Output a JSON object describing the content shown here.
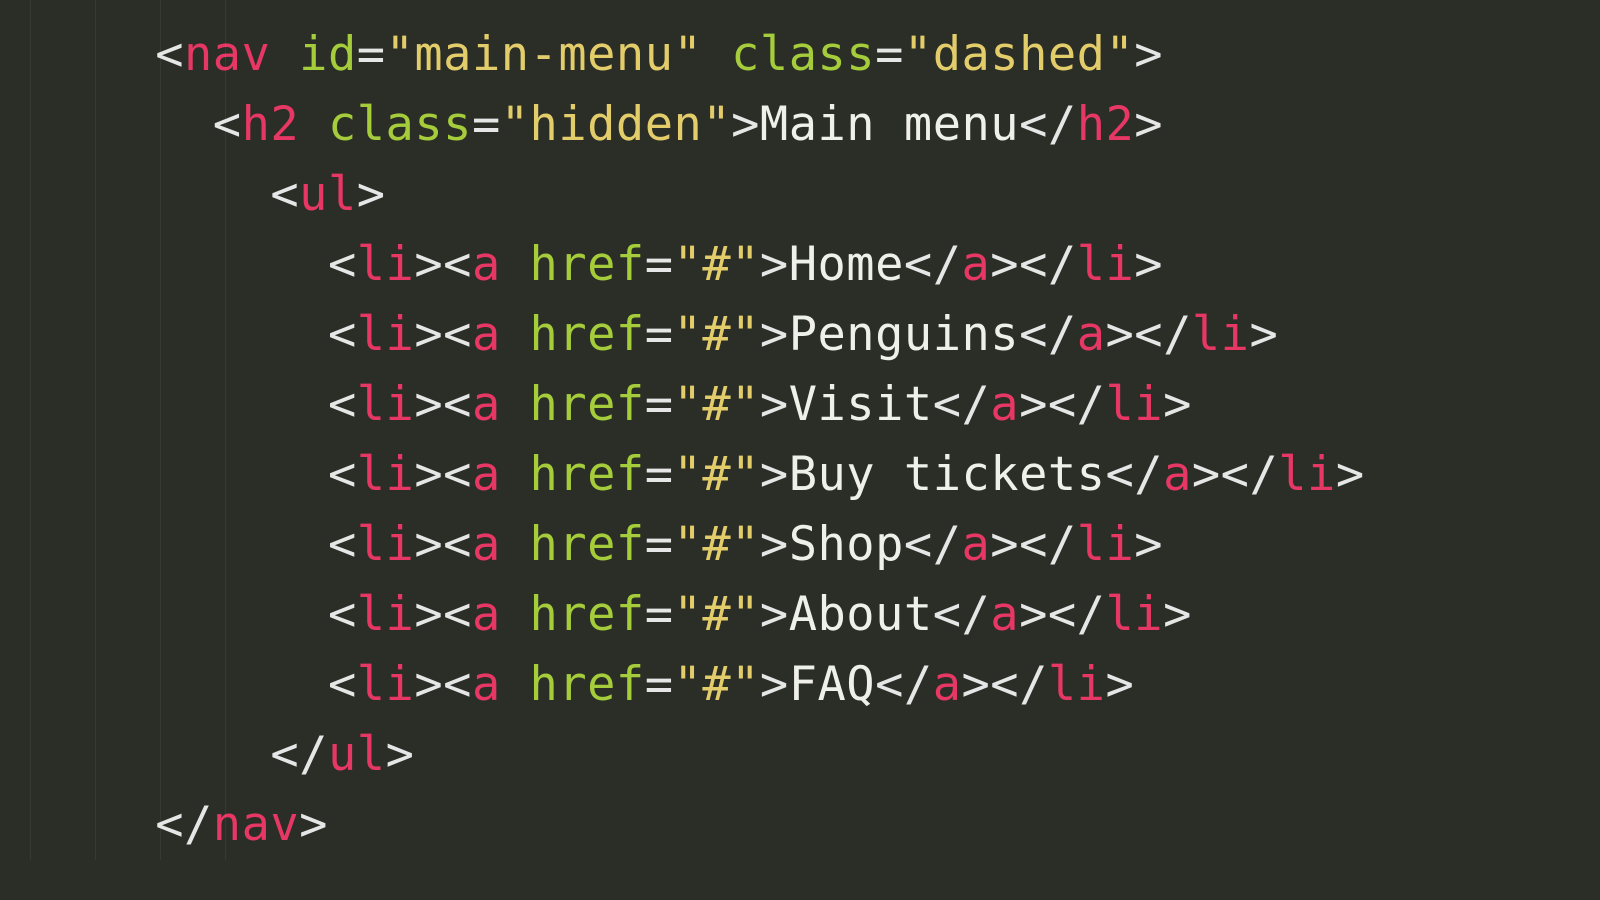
{
  "code": {
    "indent_unit": "  ",
    "nav": {
      "tag": "nav",
      "id_attr": "id",
      "id_val": "main-menu",
      "class_attr": "class",
      "class_val": "dashed"
    },
    "h2": {
      "tag": "h2",
      "class_attr": "class",
      "class_val": "hidden",
      "text": "Main menu"
    },
    "ul_tag": "ul",
    "li_tag": "li",
    "a_tag": "a",
    "href_attr": "href",
    "href_val": "#",
    "items": [
      {
        "text": "Home"
      },
      {
        "text": "Penguins"
      },
      {
        "text": "Visit"
      },
      {
        "text": "Buy tickets"
      },
      {
        "text": "Shop"
      },
      {
        "text": "About"
      },
      {
        "text": "FAQ"
      }
    ]
  },
  "colors": {
    "bg": "#2b2d27",
    "tag": "#e73765",
    "attr": "#a5cc3b",
    "string": "#e3cd6b",
    "text": "#f0f0ea"
  }
}
